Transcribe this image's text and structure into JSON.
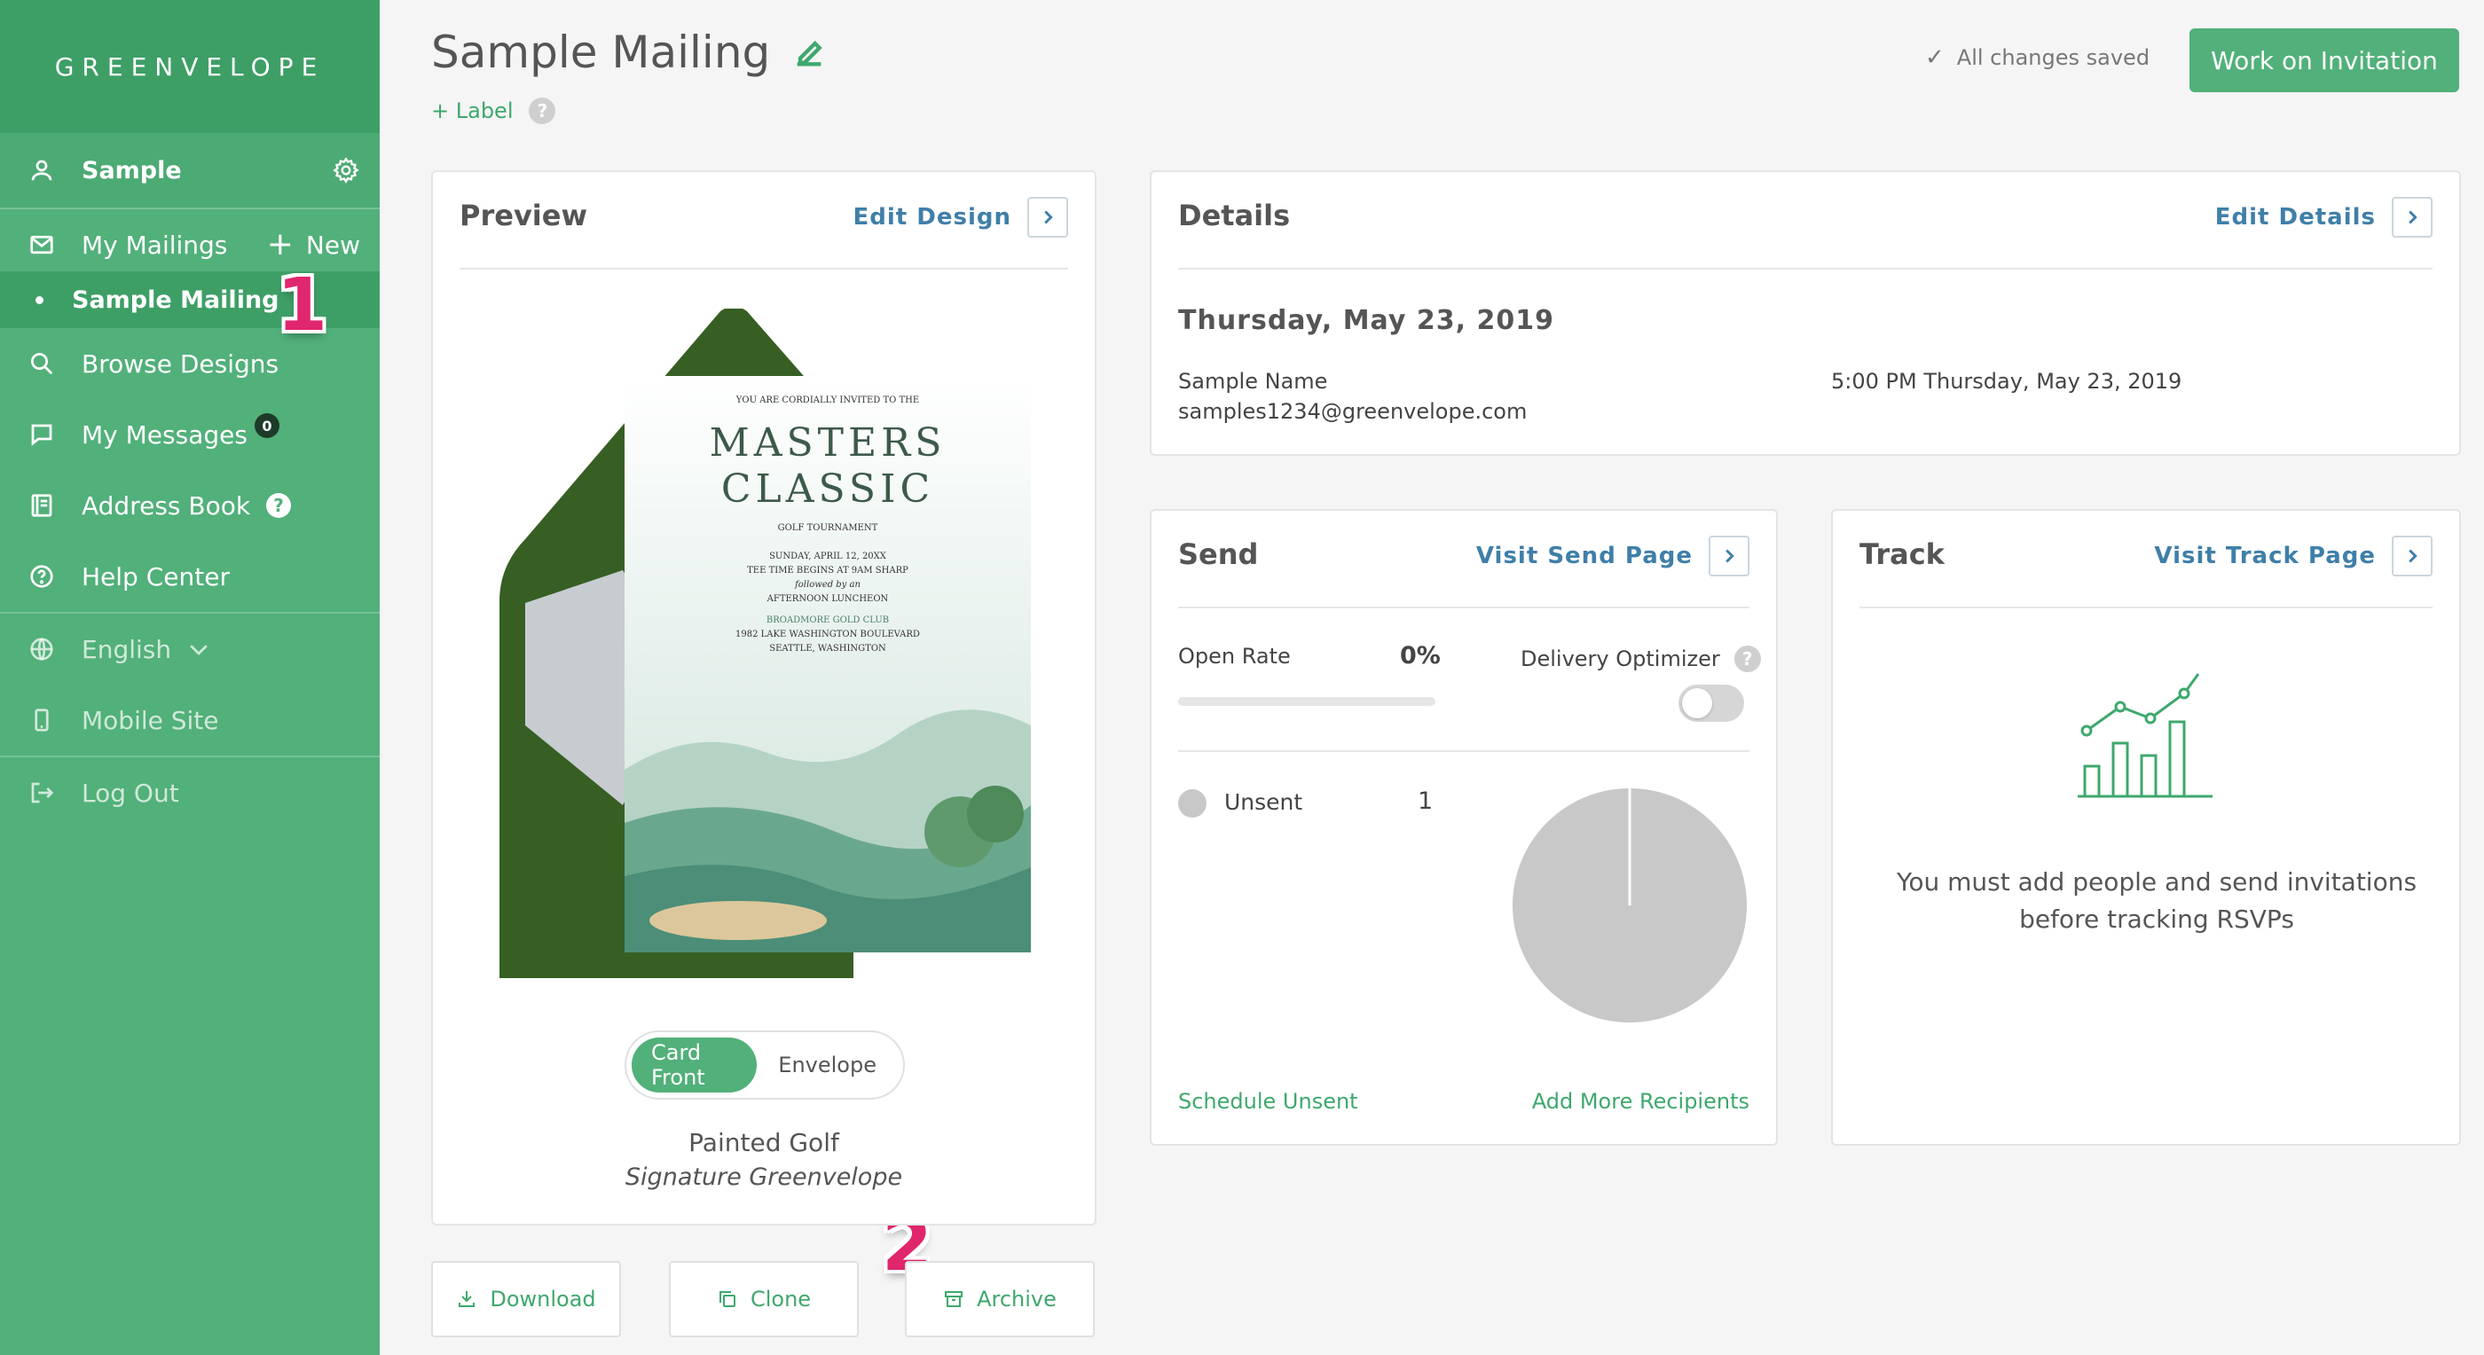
{
  "sidebar": {
    "logo": "GREENVELOPE",
    "user": "Sample",
    "my_mailings": "My Mailings",
    "new_label": "New",
    "active_mailing": "Sample Mailing",
    "browse_designs": "Browse Designs",
    "my_messages": "My Messages",
    "messages_count": "0",
    "address_book": "Address Book",
    "help_center": "Help Center",
    "language": "English",
    "mobile_site": "Mobile Site",
    "log_out": "Log Out"
  },
  "callouts": {
    "one": "1",
    "two": "2"
  },
  "header": {
    "title": "Sample Mailing",
    "label_link": "+ Label",
    "saved_status": "All changes saved",
    "work_button": "Work on Invitation"
  },
  "preview": {
    "title": "Preview",
    "edit_link": "Edit Design",
    "toggle_front": "Card Front",
    "toggle_envelope": "Envelope",
    "design_name": "Painted Golf",
    "design_line": "Signature Greenvelope",
    "card": {
      "invite": "YOU ARE CORDIALLY INVITED TO THE",
      "title1": "MASTERS",
      "title2": "CLASSIC",
      "sub": "GOLF TOURNAMENT",
      "date": "SUNDAY, APRIL 12, 20XX",
      "tee": "TEE TIME BEGINS AT 9AM SHARP",
      "followed": "followed by an",
      "lunch": "AFTERNOON LUNCHEON",
      "venue": "BROADMORE GOLD CLUB",
      "address": "1982 LAKE WASHINGTON BOULEVARD",
      "city": "SEATTLE, WASHINGTON"
    }
  },
  "actions": {
    "download": "Download",
    "clone": "Clone",
    "archive": "Archive"
  },
  "details": {
    "title": "Details",
    "edit_link": "Edit Details",
    "date": "Thursday, May 23, 2019",
    "sender_name": "Sample Name",
    "sender_email": "samples1234@greenvelope.com",
    "time": "5:00 PM Thursday, May 23, 2019"
  },
  "send": {
    "title": "Send",
    "link": "Visit Send Page",
    "open_rate_label": "Open Rate",
    "open_rate_value": "0%",
    "delivery_optimizer": "Delivery Optimizer",
    "unsent_label": "Unsent",
    "unsent_count": "1",
    "schedule_link": "Schedule Unsent",
    "add_link": "Add More Recipients"
  },
  "track": {
    "title": "Track",
    "link": "Visit Track Page",
    "message": "You must add people and send invitations before tracking RSVPs"
  },
  "colors": {
    "brand_green": "#52b07a",
    "brand_dark": "#3e9f66",
    "link_blue": "#3f7fa8",
    "callout_pink": "#e0266c"
  }
}
